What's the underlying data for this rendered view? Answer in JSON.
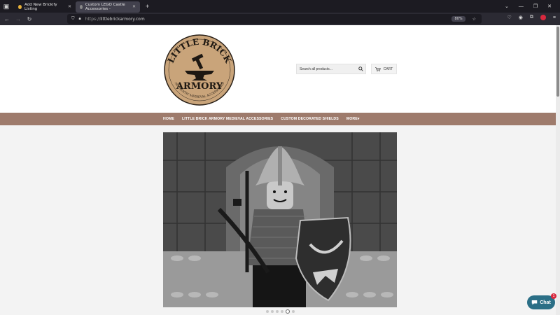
{
  "browser": {
    "tabs": [
      {
        "label": "Add New Brickify Listing",
        "active": false
      },
      {
        "label": "Custom LEGO Castle Accessories - ",
        "active": true
      }
    ],
    "new_tab": "+",
    "url_protocol": "https://",
    "url_host": "littlebrickarmory.com",
    "zoom": "80%"
  },
  "site": {
    "logo_top": "LITTLE BRICK",
    "logo_bottom": "ARMORY",
    "logo_tagline": "AUTHENTIC MEDIEVAL ACCESSORIES",
    "search_placeholder": "Search all products...",
    "cart_label": "CART",
    "menu": [
      "HOME",
      "LITTLE BRICK ARMORY MEDIEVAL ACCESSORIES",
      "CUSTOM DECORATED SHIELDS",
      "MORE"
    ],
    "slideshow_dots": 6,
    "active_dot": 5,
    "chat_label": "Chat",
    "chat_badge": "1",
    "colors": {
      "menu_bar": "#9e7b6c",
      "logo_bg": "#c9a47a",
      "chat": "#2b6f86"
    }
  }
}
